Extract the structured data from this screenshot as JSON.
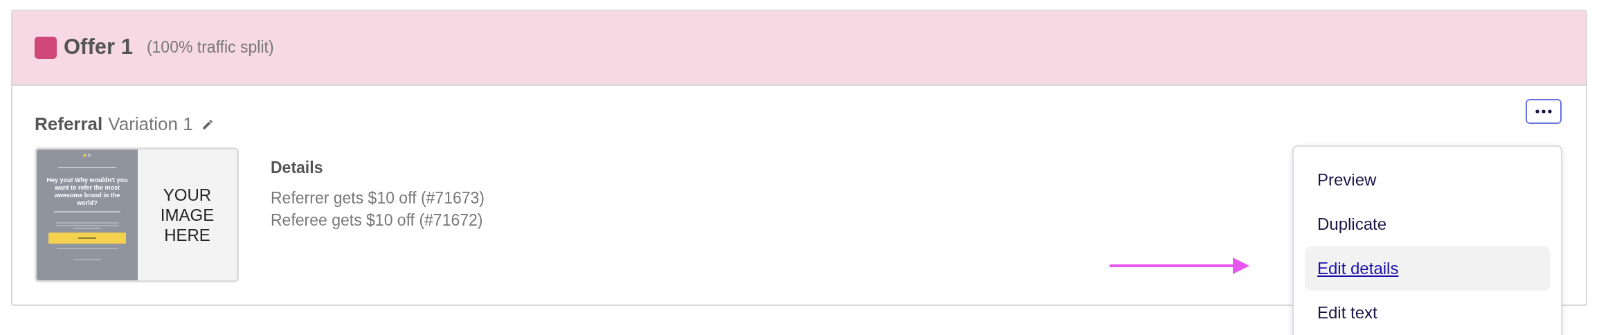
{
  "offer": {
    "color": "#d0487a",
    "title": "Offer 1",
    "split": "(100% traffic split)"
  },
  "variation": {
    "name": "Referral",
    "label": "Variation 1"
  },
  "thumbnail": {
    "headline": "Hey you! Why wouldn't you want to refer the most awesome brand in the world?",
    "image_text": "YOUR IMAGE HERE"
  },
  "details": {
    "title": "Details",
    "lines": [
      "Referrer gets $10 off (#71673)",
      "Referee gets $10 off (#71672)"
    ]
  },
  "menu": {
    "items": [
      {
        "label": "Preview",
        "selected": false
      },
      {
        "label": "Duplicate",
        "selected": false
      },
      {
        "label": "Edit details",
        "selected": true
      },
      {
        "label": "Edit text",
        "selected": false
      }
    ]
  }
}
